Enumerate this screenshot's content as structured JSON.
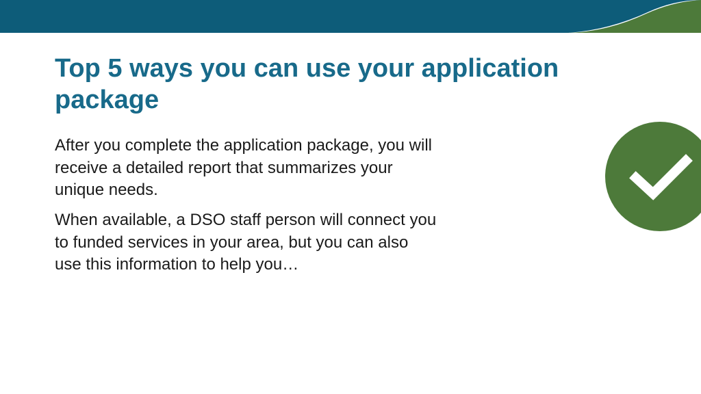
{
  "slide": {
    "title": "Top 5 ways you can use your application package",
    "paragraph1": "After you complete the application package, you will receive a  detailed report that summarizes your unique needs.",
    "paragraph2": "When available, a DSO staff person will connect you to funded services in your area, but  you can also use this information to help you…"
  },
  "colors": {
    "headerBlue": "#0d5c79",
    "titleBlue": "#186a8a",
    "accentGreen": "#4d7a3a",
    "checkGreen": "#4d7a3a"
  }
}
